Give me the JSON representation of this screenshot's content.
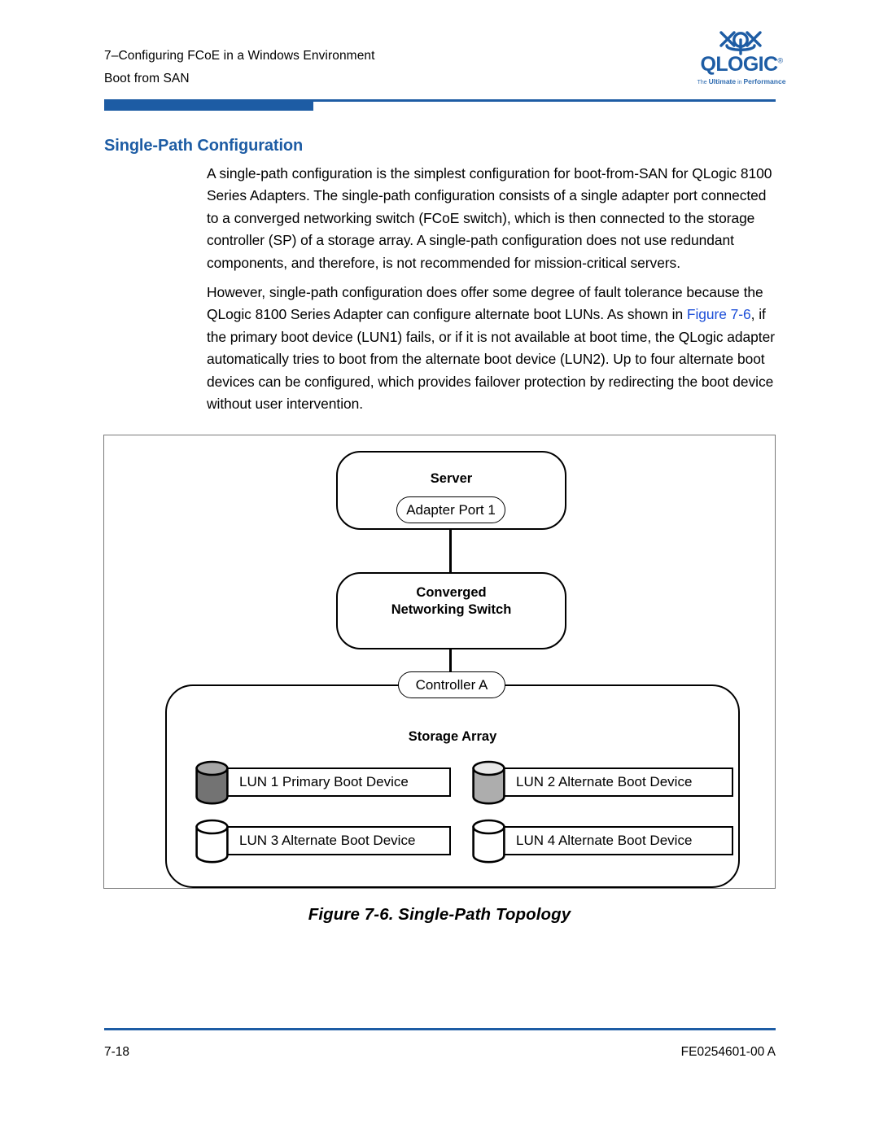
{
  "header": {
    "chapter_line": "7–Configuring FCoE in a Windows Environment",
    "section_line": "Boot from SAN",
    "rule_color": "#1d5ca4"
  },
  "logo": {
    "mark_name": "qlogic-logo-mark",
    "wordmark": "QLOGIC",
    "trademark": "®",
    "tagline_the": "The ",
    "tagline_ultimate": "Ultimate",
    "tagline_in": " in ",
    "tagline_performance": "Performance",
    "color": "#1d5ca4"
  },
  "content": {
    "section_heading": "Single-Path Configuration",
    "heading_color": "#1d5ca4",
    "paragraph_1": "A single-path configuration is the simplest configuration for boot-from-SAN for QLogic 8100 Series Adapters. The single-path configuration consists of a single adapter port connected to a converged networking switch (FCoE switch), which is then connected to the storage controller (SP) of a storage array. A single-path configuration does not use redundant components, and therefore, is not recommended for mission-critical servers.",
    "paragraph_2_a": "However, single-path configuration does offer some degree of fault tolerance because the QLogic 8100 Series Adapter can configure alternate boot LUNs. As shown in ",
    "paragraph_2_link": "Figure 7-6",
    "paragraph_2_b": ", if the primary boot device (LUN1) fails, or if it is not available at boot time, the QLogic adapter automatically tries to boot from the alternate boot device (LUN2). Up to four alternate boot devices can be configured, which provides failover protection by redirecting the boot device without user intervention.",
    "link_color": "#1d4fd8"
  },
  "figure": {
    "caption": "Figure 7-6. Single-Path Topology",
    "nodes": {
      "server": "Server",
      "adapter_port": "Adapter Port 1",
      "switch_line1": "Converged",
      "switch_line2": "Networking Switch",
      "controller": "Controller A",
      "storage_array": "Storage Array"
    },
    "luns": [
      {
        "label": "LUN 1 Primary Boot Device",
        "body_color": "#737373",
        "top_color": "#a6a6a6"
      },
      {
        "label": "LUN 2 Alternate Boot Device",
        "body_color": "#adadad",
        "top_color": "#e8e8e8"
      },
      {
        "label": "LUN 3 Alternate Boot Device",
        "body_color": "#ffffff",
        "top_color": "#ffffff"
      },
      {
        "label": "LUN 4 Alternate Boot Device",
        "body_color": "#ffffff",
        "top_color": "#ffffff"
      }
    ]
  },
  "footer": {
    "page_number": "7-18",
    "document_number": "FE0254601-00 A",
    "rule_color": "#1d5ca4"
  }
}
